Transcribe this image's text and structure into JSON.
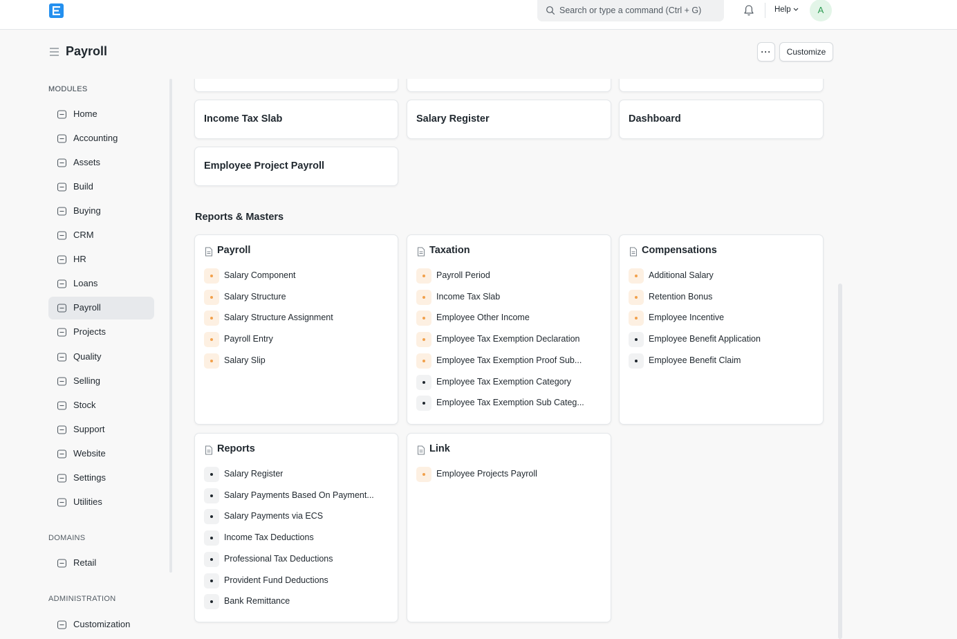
{
  "navbar": {
    "search_placeholder": "Search or type a command (Ctrl + G)",
    "help_label": "Help",
    "avatar_initial": "A",
    "brand_color": "#2490ef"
  },
  "page": {
    "title": "Payroll",
    "more_label": "···",
    "customize_label": "Customize"
  },
  "sidebar": {
    "modules_heading": "MODULES",
    "modules": [
      {
        "label": "Home",
        "icon": "home-icon"
      },
      {
        "label": "Accounting",
        "icon": "accounting-icon"
      },
      {
        "label": "Assets",
        "icon": "assets-icon"
      },
      {
        "label": "Build",
        "icon": "build-icon"
      },
      {
        "label": "Buying",
        "icon": "buying-icon"
      },
      {
        "label": "CRM",
        "icon": "crm-icon"
      },
      {
        "label": "HR",
        "icon": "hr-icon"
      },
      {
        "label": "Loans",
        "icon": "loans-icon"
      },
      {
        "label": "Payroll",
        "icon": "payroll-icon",
        "active": true
      },
      {
        "label": "Projects",
        "icon": "projects-icon"
      },
      {
        "label": "Quality",
        "icon": "quality-icon"
      },
      {
        "label": "Selling",
        "icon": "selling-icon"
      },
      {
        "label": "Stock",
        "icon": "stock-icon"
      },
      {
        "label": "Support",
        "icon": "support-icon"
      },
      {
        "label": "Website",
        "icon": "website-icon"
      },
      {
        "label": "Settings",
        "icon": "settings-icon"
      },
      {
        "label": "Utilities",
        "icon": "utilities-icon"
      }
    ],
    "domains_heading": "DOMAINS",
    "domains": [
      {
        "label": "Retail",
        "icon": "retail-icon"
      }
    ],
    "admin_heading": "ADMINISTRATION",
    "admin": [
      {
        "label": "Customization",
        "icon": "customization-icon"
      }
    ]
  },
  "shortcuts": [
    {
      "label": "Income Tax Slab"
    },
    {
      "label": "Salary Register"
    },
    {
      "label": "Dashboard"
    },
    {
      "label": "Employee Project Payroll"
    }
  ],
  "reports_masters": {
    "title": "Reports & Masters",
    "cards": [
      {
        "title": "Payroll",
        "links": [
          {
            "label": "Salary Component",
            "status": "orange"
          },
          {
            "label": "Salary Structure",
            "status": "orange"
          },
          {
            "label": "Salary Structure Assignment",
            "status": "orange"
          },
          {
            "label": "Payroll Entry",
            "status": "orange"
          },
          {
            "label": "Salary Slip",
            "status": "orange"
          }
        ]
      },
      {
        "title": "Taxation",
        "links": [
          {
            "label": "Payroll Period",
            "status": "orange"
          },
          {
            "label": "Income Tax Slab",
            "status": "orange"
          },
          {
            "label": "Employee Other Income",
            "status": "orange"
          },
          {
            "label": "Employee Tax Exemption Declaration",
            "status": "orange"
          },
          {
            "label": "Employee Tax Exemption Proof Sub...",
            "status": "orange"
          },
          {
            "label": "Employee Tax Exemption Category",
            "status": "gray"
          },
          {
            "label": "Employee Tax Exemption Sub Categ...",
            "status": "gray"
          }
        ]
      },
      {
        "title": "Compensations",
        "links": [
          {
            "label": "Additional Salary",
            "status": "orange"
          },
          {
            "label": "Retention Bonus",
            "status": "orange"
          },
          {
            "label": "Employee Incentive",
            "status": "orange"
          },
          {
            "label": "Employee Benefit Application",
            "status": "gray"
          },
          {
            "label": "Employee Benefit Claim",
            "status": "gray"
          }
        ]
      },
      {
        "title": "Reports",
        "links": [
          {
            "label": "Salary Register",
            "status": "gray"
          },
          {
            "label": "Salary Payments Based On Payment...",
            "status": "gray"
          },
          {
            "label": "Salary Payments via ECS",
            "status": "gray"
          },
          {
            "label": "Income Tax Deductions",
            "status": "gray"
          },
          {
            "label": "Professional Tax Deductions",
            "status": "gray"
          },
          {
            "label": "Provident Fund Deductions",
            "status": "gray"
          },
          {
            "label": "Bank Remittance",
            "status": "gray"
          }
        ]
      },
      {
        "title": "Link",
        "links": [
          {
            "label": "Employee Projects Payroll",
            "status": "orange"
          }
        ]
      }
    ]
  }
}
